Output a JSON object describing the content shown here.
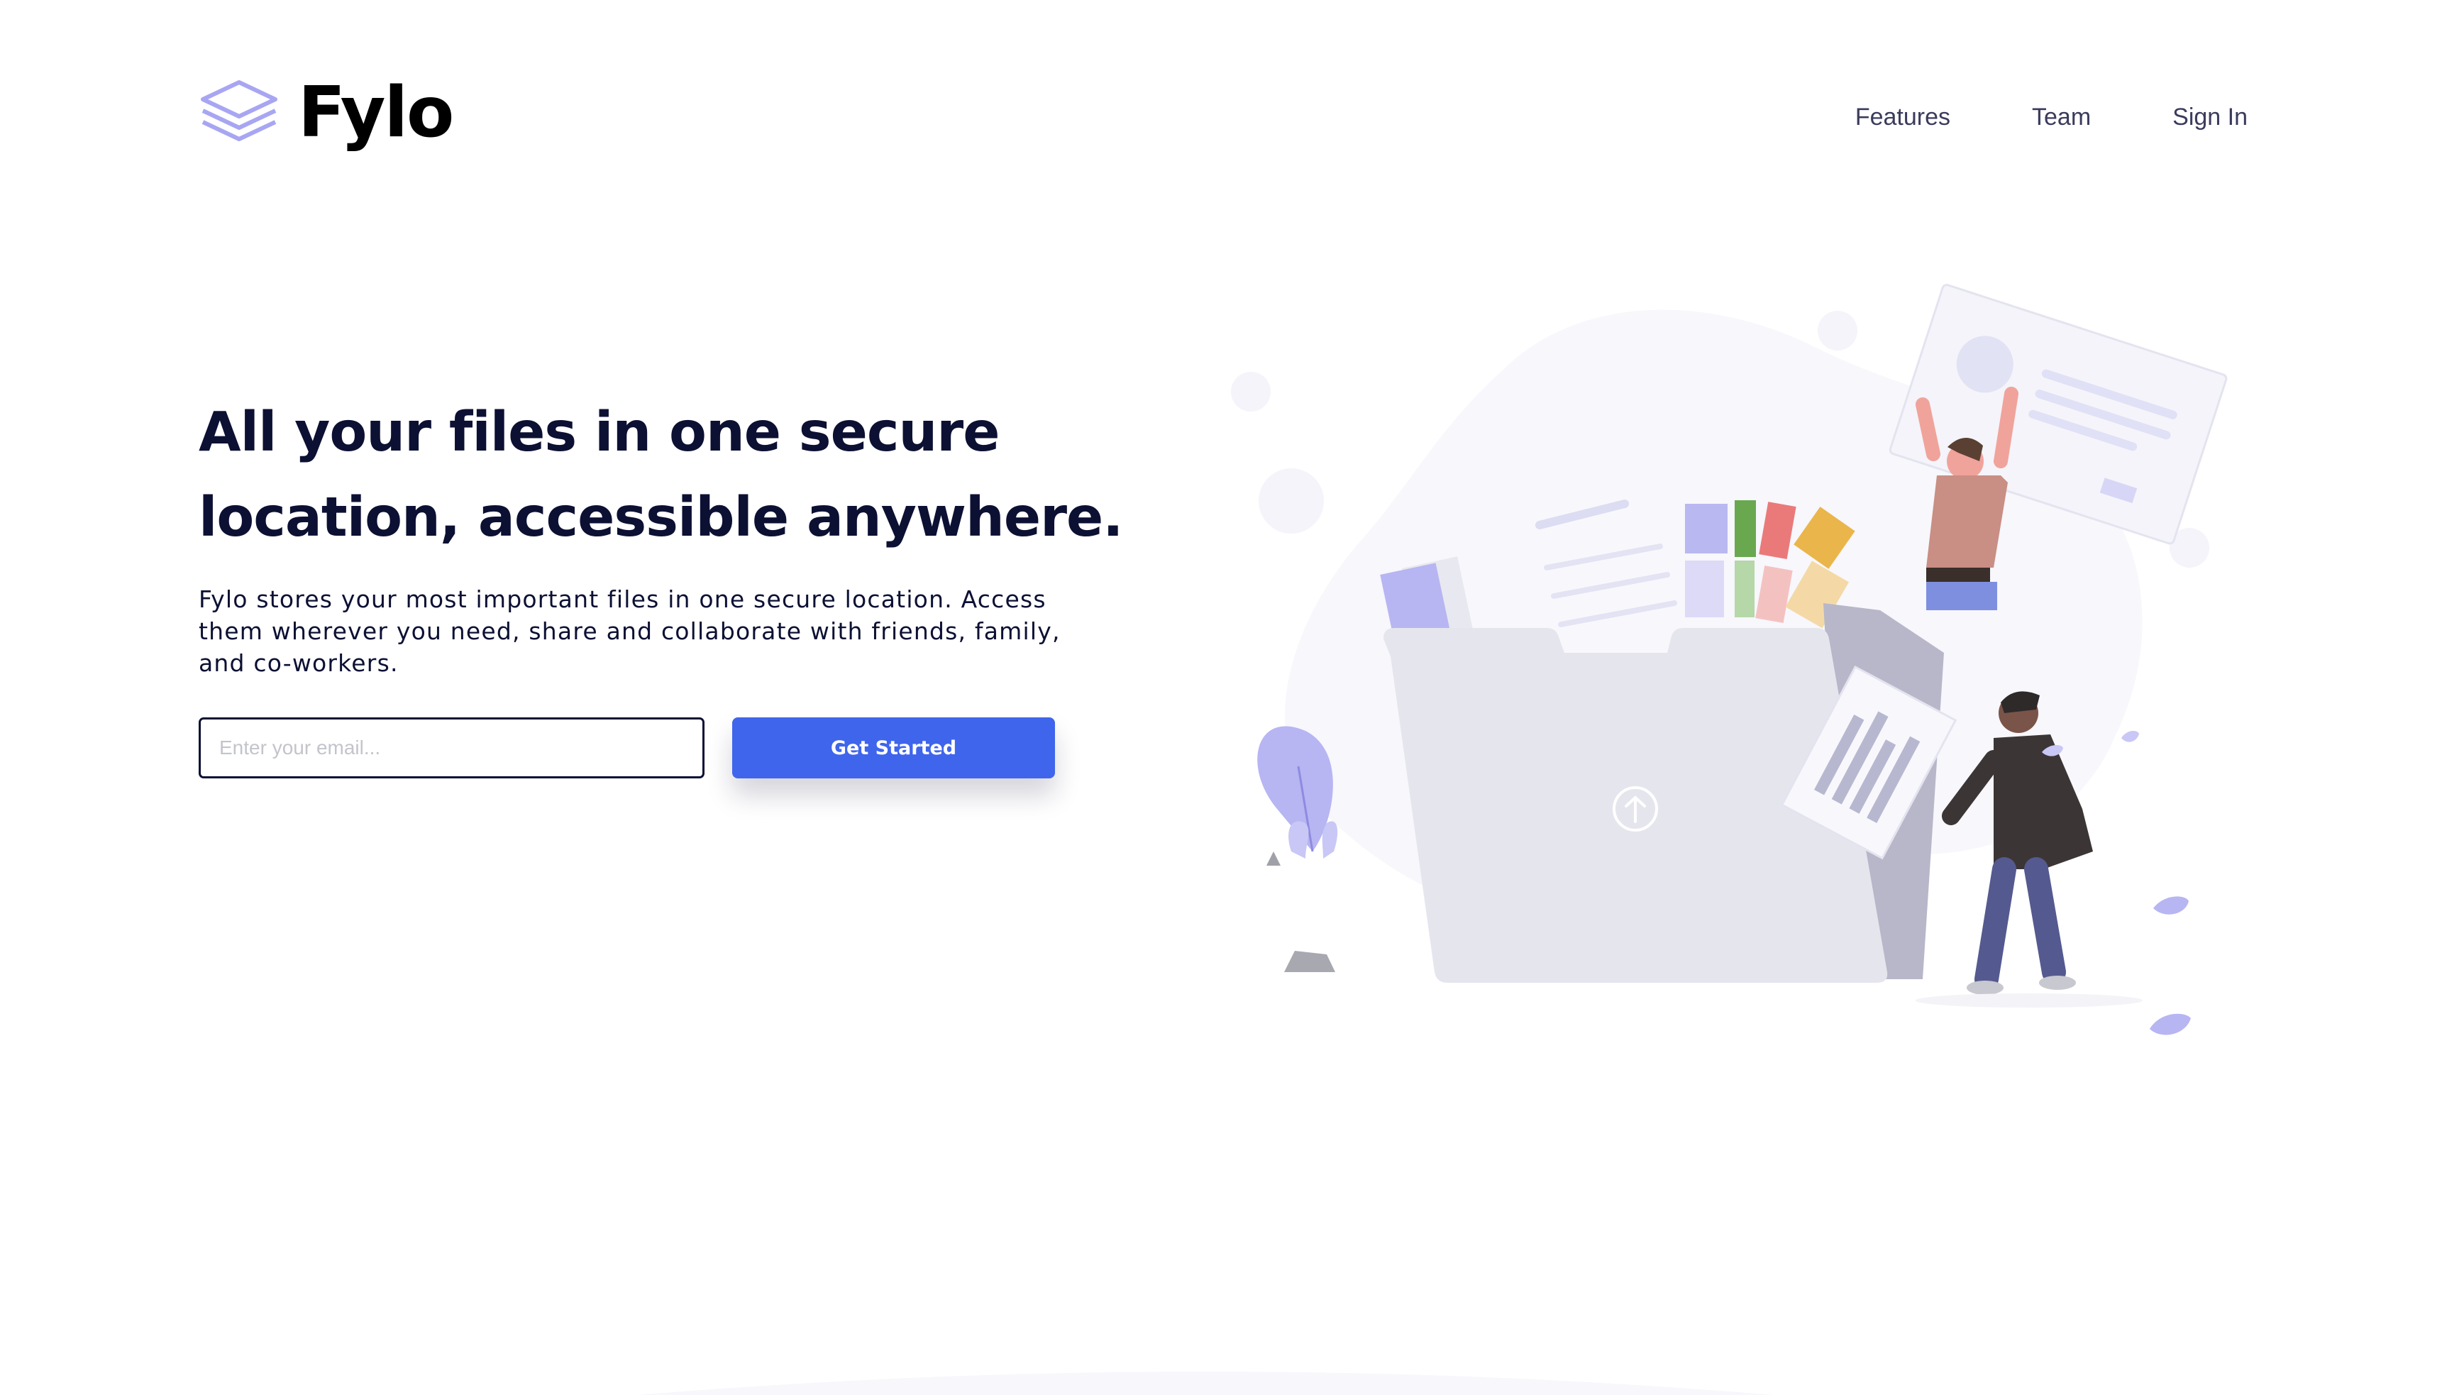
{
  "brand": {
    "name": "Fylo",
    "icon": "layers-stack-icon",
    "icon_color": "#9c9cf0"
  },
  "nav": {
    "items": [
      "Features",
      "Team",
      "Sign In"
    ]
  },
  "hero": {
    "headline": "All your files in one secure location, accessible anywhere.",
    "lead": "Fylo stores your most important files in one secure location. Access them wherever you need, share and collaborate with friends, family, and co-workers.",
    "email_placeholder": "Enter your email...",
    "cta_label": "Get Started"
  },
  "colors": {
    "heading": "#0c1033",
    "accent": "#3f65ec",
    "nav_text": "#3a3b5c",
    "illustration_blob": "#f7f7fc"
  }
}
